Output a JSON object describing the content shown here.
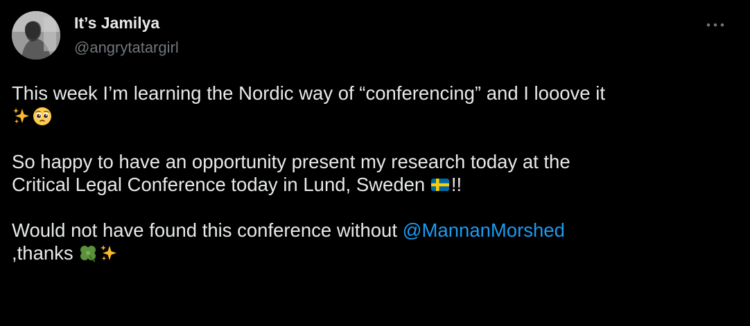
{
  "author": {
    "display_name": "It’s Jamilya",
    "handle": "@angrytatargirl",
    "avatar_icon": "profile-photo-icon"
  },
  "menu": {
    "icon": "more-options-icon"
  },
  "tweet": {
    "line1": "This week I’m learning the Nordic way of “conferencing” and I looove it",
    "p2_line1": "So happy to have an opportunity present my research today at the",
    "p2_line2_text": "Critical Legal Conference today in Lund, Sweden ",
    "p2_line2_after": "!!",
    "p3_text": "Would not have found this conference without ",
    "mention": "@MannanMorshed",
    "p3_after": ",thanks ",
    "emojis": [
      "sparkles-icon",
      "pleading-face-icon",
      "sweden-flag-icon",
      "four-leaf-clover-icon",
      "sparkles-icon"
    ]
  },
  "colors": {
    "background": "#000000",
    "text": "#e7e9ea",
    "secondary": "#71767b",
    "link": "#1d9bf0"
  }
}
